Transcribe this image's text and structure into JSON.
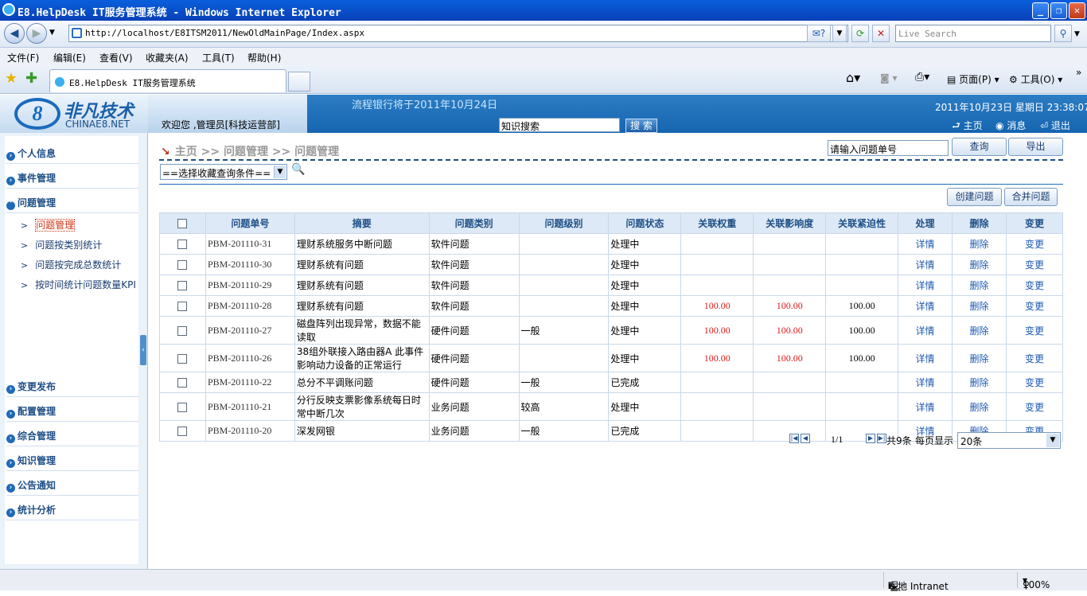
{
  "window": {
    "title": "E8.HelpDesk IT服务管理系统 - Windows Internet Explorer"
  },
  "browser": {
    "url": "http://localhost/E8ITSM2011/NewOldMainPage/Index.aspx",
    "search_placeholder": "Live Search",
    "menu": [
      "文件(F)",
      "编辑(E)",
      "查看(V)",
      "收藏夹(A)",
      "工具(T)",
      "帮助(H)"
    ],
    "tab_title": "E8.HelpDesk IT服务管理系统",
    "cmd_page": "页面(P)",
    "cmd_tools": "工具(O)"
  },
  "header": {
    "logo_cn": "非凡技术",
    "logo_en": "CHINAE8.NET",
    "logo_mark": "8",
    "welcome": "欢迎您 ,管理员[科技运营部]",
    "notice": "流程银行将于2011年10月24日",
    "kb_value": "知识搜索",
    "kb_button": "搜 索",
    "datetime": "2011年10月23日  星期日  23:38:07",
    "links": {
      "home": "主页",
      "msg": "消息",
      "logout": "退出"
    }
  },
  "sidebar": {
    "sections_top": [
      "个人信息",
      "事件管理",
      "问题管理"
    ],
    "sub_items": [
      "问题管理",
      "问题按类别统计",
      "问题按完成总数统计",
      "按时间统计问题数量KPI"
    ],
    "sections_bottom": [
      "变更发布",
      "配置管理",
      "综合管理",
      "知识管理",
      "公告通知",
      "统计分析"
    ]
  },
  "main": {
    "breadcrumb": "主页  >> 问题管理  >> 问题管理",
    "search_value": "请输入问题单号",
    "query_btn": "查询",
    "export_btn": "导出",
    "fav_select": "==选择收藏查询条件==",
    "create_btn": "创建问题",
    "merge_btn": "合并问题",
    "columns": [
      "问题单号",
      "摘要",
      "问题类别",
      "问题级别",
      "问题状态",
      "关联权重",
      "关联影响度",
      "关联紧迫性",
      "处理",
      "删除",
      "变更"
    ],
    "rows": [
      {
        "id": "PBM-201110-31",
        "summary": "理财系统服务中断问题",
        "category": "软件问题",
        "level": "",
        "status": "处理中",
        "weight": "",
        "impact": "",
        "urgency": "",
        "detail": "详情",
        "delete": "删除",
        "change": "变更"
      },
      {
        "id": "PBM-201110-30",
        "summary": "理财系统有问题",
        "category": "软件问题",
        "level": "",
        "status": "处理中",
        "weight": "",
        "impact": "",
        "urgency": "",
        "detail": "详情",
        "delete": "删除",
        "change": "变更"
      },
      {
        "id": "PBM-201110-29",
        "summary": "理财系统有问题",
        "category": "软件问题",
        "level": "",
        "status": "处理中",
        "weight": "",
        "impact": "",
        "urgency": "",
        "detail": "详情",
        "delete": "删除",
        "change": "变更"
      },
      {
        "id": "PBM-201110-28",
        "summary": "理财系统有问题",
        "category": "软件问题",
        "level": "",
        "status": "处理中",
        "weight": "100.00",
        "impact": "100.00",
        "urgency": "100.00",
        "detail": "详情",
        "delete": "删除",
        "change": "变更"
      },
      {
        "id": "PBM-201110-27",
        "summary": "磁盘阵列出现异常，数据不能读取",
        "category": "硬件问题",
        "level": "一般",
        "status": "处理中",
        "weight": "100.00",
        "impact": "100.00",
        "urgency": "100.00",
        "detail": "详情",
        "delete": "删除",
        "change": "变更"
      },
      {
        "id": "PBM-201110-26",
        "summary": "38组外联接入路由器A 此事件影响动力设备的正常运行",
        "category": "硬件问题",
        "level": "",
        "status": "处理中",
        "weight": "100.00",
        "impact": "100.00",
        "urgency": "100.00",
        "detail": "详情",
        "delete": "删除",
        "change": "变更"
      },
      {
        "id": "PBM-201110-22",
        "summary": "总分不平调账问题",
        "category": "硬件问题",
        "level": "一般",
        "status": "已完成",
        "weight": "",
        "impact": "",
        "urgency": "",
        "detail": "详情",
        "delete": "删除",
        "change": "变更"
      },
      {
        "id": "PBM-201110-21",
        "summary": "分行反映支票影像系统每日时常中断几次",
        "category": "业务问题",
        "level": "较高",
        "status": "处理中",
        "weight": "",
        "impact": "",
        "urgency": "",
        "detail": "详情",
        "delete": "删除",
        "change": "变更"
      },
      {
        "id": "PBM-201110-20",
        "summary": "深发网银",
        "category": "业务问题",
        "level": "一般",
        "status": "已完成",
        "weight": "",
        "impact": "",
        "urgency": "",
        "detail": "详情",
        "delete": "删除",
        "change": "变更"
      }
    ],
    "pager": {
      "page": "1/1",
      "total": "共9条",
      "per_page_label": "每页显示",
      "per_page": "20条"
    }
  },
  "statusbar": {
    "zone": "本地 Intranet",
    "zoom": "100%"
  },
  "colors": {
    "accent": "#1565b0",
    "link": "#1e5ab0",
    "danger": "#e01818",
    "header_text": "#1e4f86"
  }
}
